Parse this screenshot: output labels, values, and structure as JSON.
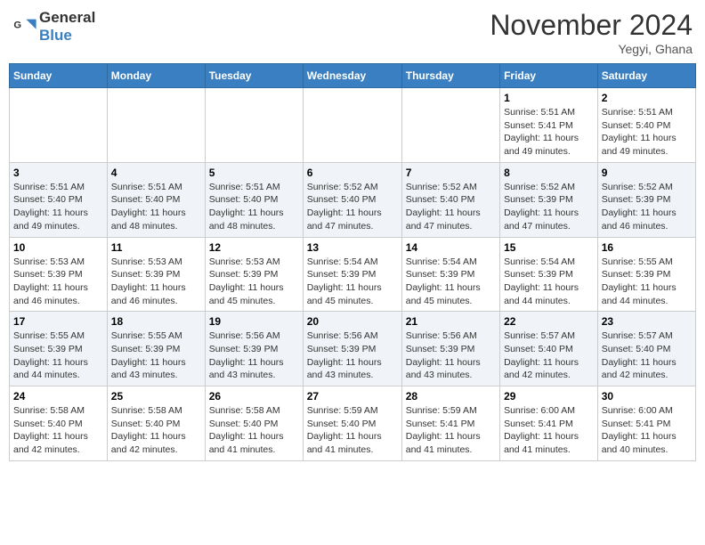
{
  "header": {
    "logo_general": "General",
    "logo_blue": "Blue",
    "month": "November 2024",
    "location": "Yegyi, Ghana"
  },
  "weekdays": [
    "Sunday",
    "Monday",
    "Tuesday",
    "Wednesday",
    "Thursday",
    "Friday",
    "Saturday"
  ],
  "weeks": [
    [
      {
        "day": "",
        "info": ""
      },
      {
        "day": "",
        "info": ""
      },
      {
        "day": "",
        "info": ""
      },
      {
        "day": "",
        "info": ""
      },
      {
        "day": "",
        "info": ""
      },
      {
        "day": "1",
        "info": "Sunrise: 5:51 AM\nSunset: 5:41 PM\nDaylight: 11 hours\nand 49 minutes."
      },
      {
        "day": "2",
        "info": "Sunrise: 5:51 AM\nSunset: 5:40 PM\nDaylight: 11 hours\nand 49 minutes."
      }
    ],
    [
      {
        "day": "3",
        "info": "Sunrise: 5:51 AM\nSunset: 5:40 PM\nDaylight: 11 hours\nand 49 minutes."
      },
      {
        "day": "4",
        "info": "Sunrise: 5:51 AM\nSunset: 5:40 PM\nDaylight: 11 hours\nand 48 minutes."
      },
      {
        "day": "5",
        "info": "Sunrise: 5:51 AM\nSunset: 5:40 PM\nDaylight: 11 hours\nand 48 minutes."
      },
      {
        "day": "6",
        "info": "Sunrise: 5:52 AM\nSunset: 5:40 PM\nDaylight: 11 hours\nand 47 minutes."
      },
      {
        "day": "7",
        "info": "Sunrise: 5:52 AM\nSunset: 5:40 PM\nDaylight: 11 hours\nand 47 minutes."
      },
      {
        "day": "8",
        "info": "Sunrise: 5:52 AM\nSunset: 5:39 PM\nDaylight: 11 hours\nand 47 minutes."
      },
      {
        "day": "9",
        "info": "Sunrise: 5:52 AM\nSunset: 5:39 PM\nDaylight: 11 hours\nand 46 minutes."
      }
    ],
    [
      {
        "day": "10",
        "info": "Sunrise: 5:53 AM\nSunset: 5:39 PM\nDaylight: 11 hours\nand 46 minutes."
      },
      {
        "day": "11",
        "info": "Sunrise: 5:53 AM\nSunset: 5:39 PM\nDaylight: 11 hours\nand 46 minutes."
      },
      {
        "day": "12",
        "info": "Sunrise: 5:53 AM\nSunset: 5:39 PM\nDaylight: 11 hours\nand 45 minutes."
      },
      {
        "day": "13",
        "info": "Sunrise: 5:54 AM\nSunset: 5:39 PM\nDaylight: 11 hours\nand 45 minutes."
      },
      {
        "day": "14",
        "info": "Sunrise: 5:54 AM\nSunset: 5:39 PM\nDaylight: 11 hours\nand 45 minutes."
      },
      {
        "day": "15",
        "info": "Sunrise: 5:54 AM\nSunset: 5:39 PM\nDaylight: 11 hours\nand 44 minutes."
      },
      {
        "day": "16",
        "info": "Sunrise: 5:55 AM\nSunset: 5:39 PM\nDaylight: 11 hours\nand 44 minutes."
      }
    ],
    [
      {
        "day": "17",
        "info": "Sunrise: 5:55 AM\nSunset: 5:39 PM\nDaylight: 11 hours\nand 44 minutes."
      },
      {
        "day": "18",
        "info": "Sunrise: 5:55 AM\nSunset: 5:39 PM\nDaylight: 11 hours\nand 43 minutes."
      },
      {
        "day": "19",
        "info": "Sunrise: 5:56 AM\nSunset: 5:39 PM\nDaylight: 11 hours\nand 43 minutes."
      },
      {
        "day": "20",
        "info": "Sunrise: 5:56 AM\nSunset: 5:39 PM\nDaylight: 11 hours\nand 43 minutes."
      },
      {
        "day": "21",
        "info": "Sunrise: 5:56 AM\nSunset: 5:39 PM\nDaylight: 11 hours\nand 43 minutes."
      },
      {
        "day": "22",
        "info": "Sunrise: 5:57 AM\nSunset: 5:40 PM\nDaylight: 11 hours\nand 42 minutes."
      },
      {
        "day": "23",
        "info": "Sunrise: 5:57 AM\nSunset: 5:40 PM\nDaylight: 11 hours\nand 42 minutes."
      }
    ],
    [
      {
        "day": "24",
        "info": "Sunrise: 5:58 AM\nSunset: 5:40 PM\nDaylight: 11 hours\nand 42 minutes."
      },
      {
        "day": "25",
        "info": "Sunrise: 5:58 AM\nSunset: 5:40 PM\nDaylight: 11 hours\nand 42 minutes."
      },
      {
        "day": "26",
        "info": "Sunrise: 5:58 AM\nSunset: 5:40 PM\nDaylight: 11 hours\nand 41 minutes."
      },
      {
        "day": "27",
        "info": "Sunrise: 5:59 AM\nSunset: 5:40 PM\nDaylight: 11 hours\nand 41 minutes."
      },
      {
        "day": "28",
        "info": "Sunrise: 5:59 AM\nSunset: 5:41 PM\nDaylight: 11 hours\nand 41 minutes."
      },
      {
        "day": "29",
        "info": "Sunrise: 6:00 AM\nSunset: 5:41 PM\nDaylight: 11 hours\nand 41 minutes."
      },
      {
        "day": "30",
        "info": "Sunrise: 6:00 AM\nSunset: 5:41 PM\nDaylight: 11 hours\nand 40 minutes."
      }
    ]
  ]
}
